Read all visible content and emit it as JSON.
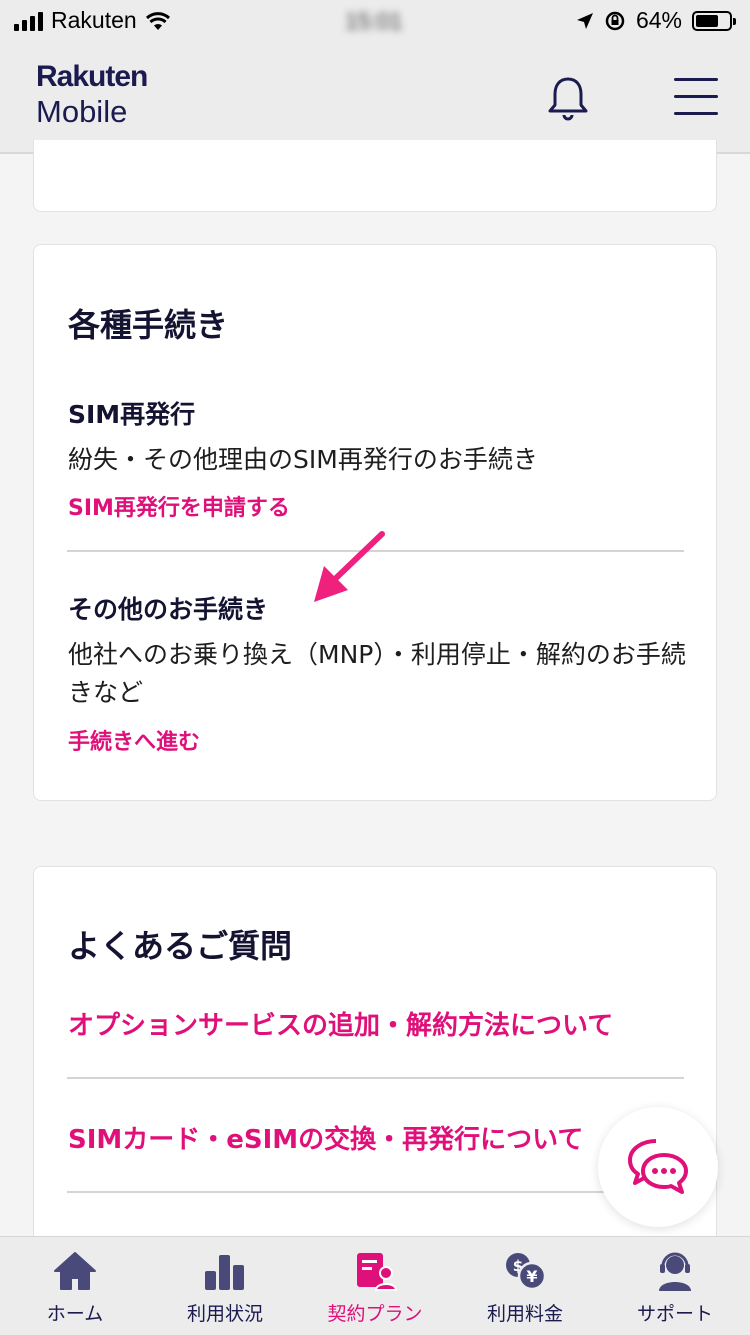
{
  "status_bar": {
    "carrier": "Rakuten",
    "time": "15:01",
    "battery": "64%"
  },
  "header": {
    "logo_line1": "Rakuten",
    "logo_line2": "Mobile"
  },
  "procedures": {
    "title": "各種手続き",
    "items": [
      {
        "title": "SIM再発行",
        "desc": "紛失・その他理由のSIM再発行のお手続き",
        "link": "SIM再発行を申請する"
      },
      {
        "title": "その他のお手続き",
        "desc": "他社へのお乗り換え（MNP）・利用停止・解約のお手続きなど",
        "link": "手続きへ進む"
      }
    ]
  },
  "faq": {
    "title": "よくあるご質問",
    "links": [
      "オプションサービスの追加・解約方法について",
      "SIMカード・eSIMの交換・再発行について"
    ]
  },
  "bottom_nav": [
    {
      "label": "ホーム",
      "icon": "home-icon"
    },
    {
      "label": "利用状況",
      "icon": "bar-chart-icon"
    },
    {
      "label": "契約プラン",
      "icon": "contract-icon",
      "active": true
    },
    {
      "label": "利用料金",
      "icon": "yen-coin-icon"
    },
    {
      "label": "サポート",
      "icon": "support-headset-icon"
    }
  ],
  "colors": {
    "accent": "#e0107a",
    "navy": "#1c1b4f",
    "background": "#f4f4f4"
  }
}
